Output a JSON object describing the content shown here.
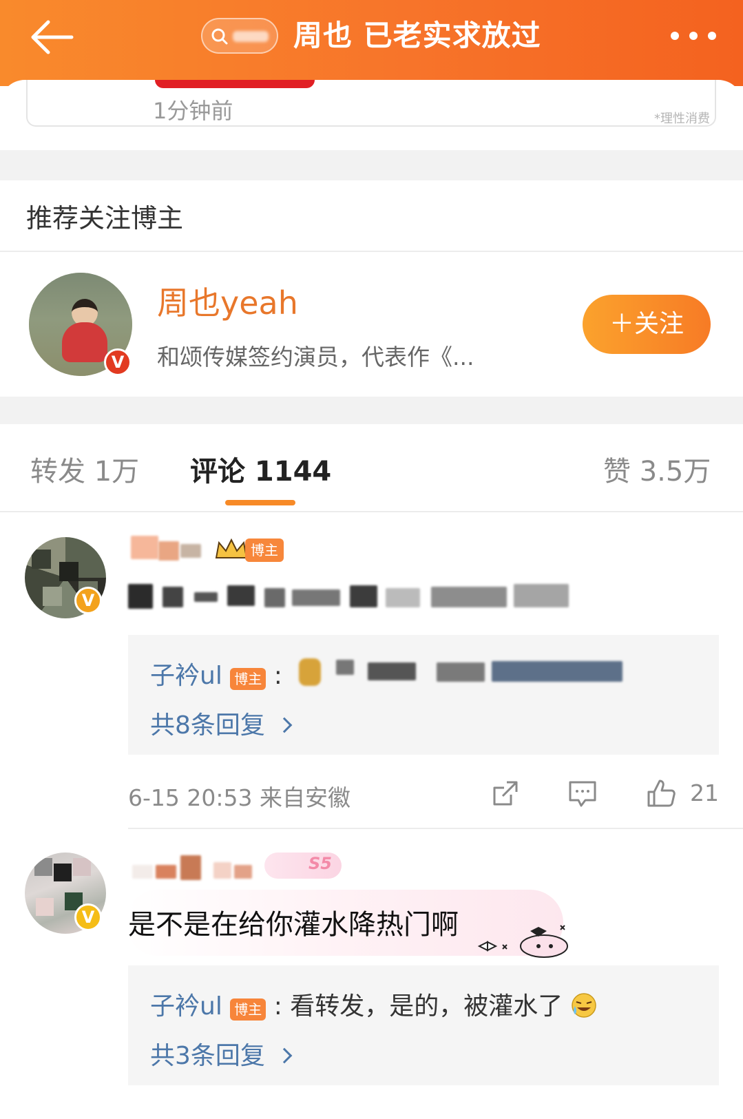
{
  "header": {
    "title": "周也 已老实求放过",
    "back_icon": "arrow-left-icon",
    "search_icon": "search-icon",
    "more_icon": "more-horizontal-icon",
    "background": "#f7742a"
  },
  "ad": {
    "time": "1分钟前",
    "note": "*理性消费"
  },
  "recommend": {
    "title": "推荐关注博主",
    "blogger": {
      "name": "周也yeah",
      "description": "和颂传媒签约演员，代表作《...",
      "verified_badge": "V",
      "follow_label": "＋关注"
    }
  },
  "tabs": {
    "repost": "转发 1万",
    "comment": "评论 1144",
    "like": "赞 3.5万",
    "active": "comment"
  },
  "comments": [
    {
      "badge": "V",
      "tag": "博主",
      "reply_preview": {
        "user": "子衿ul",
        "tag": "博主",
        "colon": ":"
      },
      "reply_count": "共8条回复",
      "time_location": "6-15 20:53 来自安徽",
      "likes": "21",
      "icons": [
        "share-icon",
        "comment-icon",
        "thumbs-up-icon"
      ]
    },
    {
      "badge": "V",
      "fan_badge": "S5",
      "text": "是不是在给你灌水降热门啊",
      "reply_preview": {
        "user": "子衿ul",
        "tag": "博主",
        "text": ": 看转发，是的，被灌水了"
      },
      "reply_count": "共3条回复"
    }
  ],
  "colors": {
    "accent": "#f78a27",
    "link": "#4c77a9",
    "blogger_name": "#e8772b"
  }
}
